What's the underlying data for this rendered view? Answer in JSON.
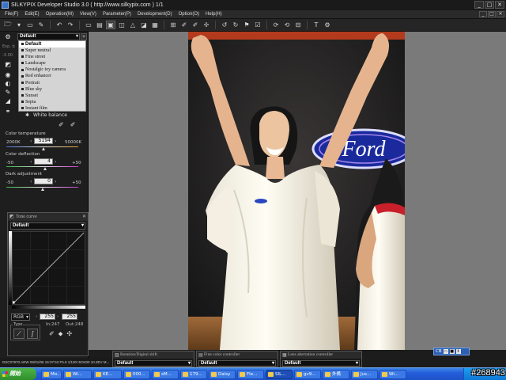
{
  "window": {
    "title": "SILKYPIX Developer Studio 3.0 ( http://www.silkypix.com )    1/1"
  },
  "menu": [
    "File(F)",
    "Edit(E)",
    "Operation(M)",
    "View(V)",
    "Parameter(P)",
    "Development(D)",
    "Option(O)",
    "Help(H)"
  ],
  "left_panel": {
    "preset_select": "Default",
    "exposure_label": "Exp. b",
    "exposure_value": "-3.00",
    "presets": [
      "Default",
      "Super neutral",
      "Fine street",
      "Landscape",
      "Nostalgic toy camera",
      "Red enhancer",
      "Portrait",
      "Blue sky",
      "Sunset",
      "Sepia",
      "Instant film"
    ],
    "selected_preset_index": 0,
    "white_balance_label": "White balance",
    "color_temperature": {
      "label": "Color temperature",
      "min": "2000K",
      "max": "50000K",
      "value": "5194",
      "position": 0.52
    },
    "color_deflection": {
      "label": "Color deflection",
      "min": "-50",
      "max": "+50",
      "value": "4",
      "position": 0.54
    },
    "dark_adjustment": {
      "label": "Dark adjustment",
      "min": "-50",
      "max": "+50",
      "value": "0",
      "position": 0.5
    }
  },
  "tone_curve": {
    "title": "Tone curve",
    "preset": "Default",
    "channel": "RGB",
    "in_value": "255",
    "out_value": "255",
    "in_readout": "In:247",
    "out_readout": "Out:248",
    "type_label": "Type"
  },
  "sub_panels": [
    {
      "title": "Rotation/Digital shift",
      "preset": "Default"
    },
    {
      "title": "Fine color controller",
      "preset": "Default"
    },
    {
      "title": "Lens aberration controller",
      "preset": "Default"
    }
  ],
  "status_bar": "DSC07970.ARW 09/01/06 16:37:53 F5.6 1/100 ISO400 10.3EV  M...",
  "zoom": {
    "label": "CB",
    "mid": "■"
  },
  "taskbar": {
    "start": "開始",
    "items": [
      "Mo...",
      "Wi...",
      "KE...",
      "000...",
      "sM...",
      "179...",
      "Daisy",
      "Fle...",
      "SIL...",
      "gv9...",
      "外備",
      "Jus...",
      "Wi..."
    ]
  },
  "watermark": "#268943"
}
